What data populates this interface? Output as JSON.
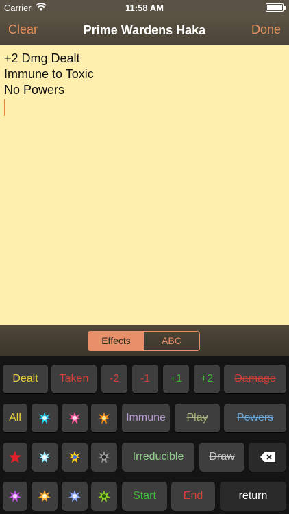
{
  "status": {
    "carrier": "Carrier",
    "time": "11:58 AM",
    "battery_level": 1.0
  },
  "nav": {
    "clear": "Clear",
    "title": "Prime Wardens Haka",
    "done": "Done"
  },
  "notes": {
    "lines": [
      "+2 Dmg Dealt",
      "Immune to Toxic",
      "No Powers"
    ]
  },
  "segment": {
    "effects": "Effects",
    "abc": "ABC",
    "selected": "Effects"
  },
  "keys": {
    "dealt": "Dealt",
    "taken": "Taken",
    "minus2": "-2",
    "minus1": "-1",
    "plus1": "+1",
    "plus2": "+2",
    "damage": "Damage",
    "all": "All",
    "immune": "Immune",
    "play": "Play",
    "powers": "Powers",
    "irreducible": "Irreducible",
    "draw": "Draw",
    "start": "Start",
    "end": "End",
    "return": "return"
  },
  "colors": {
    "accent": "#e8906a",
    "yellow": "#e9d13a",
    "red": "#d2403a",
    "green": "#3fbd3a",
    "lavender": "#b89ad6",
    "olive": "#a7b57a",
    "blue": "#6aa6d6",
    "mint": "#8fcf8a",
    "cyan": "#22d0f0",
    "pink": "#ff5aa0",
    "orange": "#f58a1a",
    "crimson": "#e0202a",
    "gold": "#ffd21a",
    "gray": "#9a9a9a",
    "violet": "#c455e8",
    "amber": "#ffaa33",
    "periwinkle": "#8aa6ff",
    "lime": "#8ccf22",
    "ice": "#9aeaff"
  },
  "icons": {
    "row2": [
      "cyan-burst-icon",
      "pink-burst-icon",
      "orange-burst-icon"
    ],
    "row3": [
      "red-star-icon",
      "ice-burst-icon",
      "yellow-burst-icon",
      "gray-burst-icon"
    ],
    "row4": [
      "violet-burst-icon",
      "amber-burst-icon",
      "blue-burst-icon",
      "green-burst-icon"
    ],
    "backspace": "backspace-icon"
  }
}
